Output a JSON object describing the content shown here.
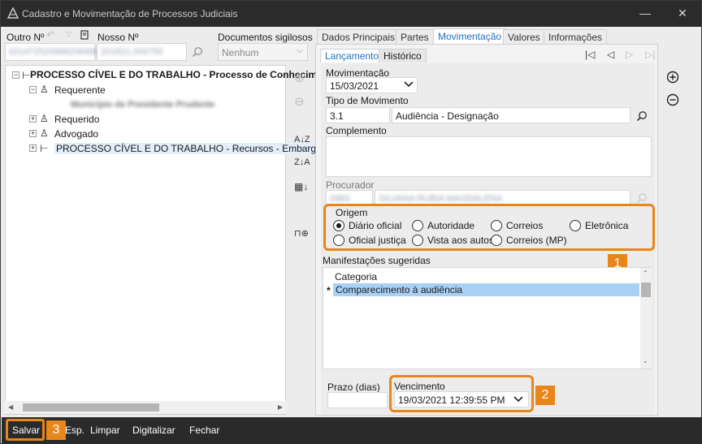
{
  "window": {
    "title": "Cadastro e Movimentação de Processos Judiciais",
    "minimize": "—",
    "maximize": "☐",
    "close": "✕"
  },
  "header": {
    "outro_label": "Outro Nº",
    "nosso_label": "Nosso Nº",
    "outro_value": "0214725209982064668",
    "nosso_value": "201621.000755",
    "docs_label": "Documentos sigilosos",
    "docs_value": "Nenhum"
  },
  "tree": {
    "items": [
      {
        "label": "PROCESSO CÍVEL E DO TRABALHO - Processo de Conhecim"
      },
      {
        "label": "Requerente"
      },
      {
        "label": "Município de Presidente Prudente"
      },
      {
        "label": "Requerido"
      },
      {
        "label": "Advogado"
      },
      {
        "label": "PROCESSO CÍVEL E DO TRABALHO - Recursos - Embargo"
      }
    ]
  },
  "tabs": [
    "Dados Principais",
    "Partes",
    "Movimentação",
    "Valores",
    "Informações"
  ],
  "subtabs": [
    "Lançamento",
    "Histórico"
  ],
  "nav": {
    "first": "|◁",
    "prev": "◁",
    "next": "▷",
    "last": "▷|"
  },
  "form": {
    "movimentacao_label": "Movimentação",
    "movimentacao_value": "15/03/2021",
    "tipo_label": "Tipo de Movimento",
    "tipo_code": "3.1",
    "tipo_desc": "Audiência - Designação",
    "complemento_label": "Complemento",
    "procurador_label": "Procurador",
    "procurador_code": "0983",
    "procurador_name": "SILVANA RUBIA MAGDALENA",
    "origem_label": "Origem",
    "origem_options": [
      "Diário oficial",
      "Autoridade",
      "Correios",
      "Eletrônica",
      "Oficial justiça",
      "Vista aos autos",
      "Correios (MP)"
    ],
    "origem_selected": "Diário oficial",
    "manifestacoes_label": "Manifestações sugeridas",
    "categoria_header": "Categoria",
    "categoria_rows": [
      "Comparecimento à audiência"
    ],
    "row_marker": "*",
    "prazo_label": "Prazo (dias)",
    "prazo_value": "",
    "vencimento_label": "Vencimento",
    "vencimento_value": "19/03/2021 12:39:55 PM"
  },
  "badges": [
    "1",
    "2",
    "3"
  ],
  "bottom": {
    "salvar": "Salvar",
    "esp": "Esp.",
    "limpar": "Limpar",
    "digitalizar": "Digitalizar",
    "fechar": "Fechar"
  },
  "colors": {
    "accent": "#1f6fc0",
    "highlight": "#e8861a",
    "selection": "#a9d0f5",
    "titlebar": "#2b2b2b"
  }
}
